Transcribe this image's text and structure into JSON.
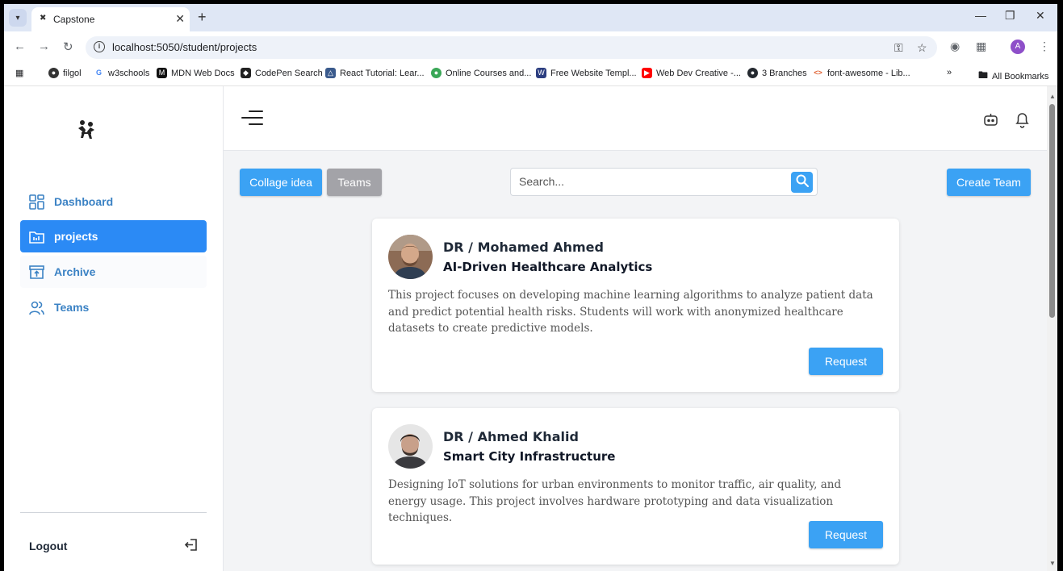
{
  "browser": {
    "tab_title": "Capstone",
    "url": "localhost:5050/student/projects",
    "profile_initial": "A",
    "bookmarks": [
      {
        "label": "filgol",
        "color": "#333333"
      },
      {
        "label": "w3schools",
        "color": "#4285f4"
      },
      {
        "label": "MDN Web Docs",
        "color": "#111111"
      },
      {
        "label": "CodePen Search",
        "color": "#222222"
      },
      {
        "label": "React Tutorial: Lear...",
        "color": "#3a5a8c"
      },
      {
        "label": "Online Courses and...",
        "color": "#3aa757"
      },
      {
        "label": "Free Website Templ...",
        "color": "#2c3e80"
      },
      {
        "label": "Web Dev Creative -...",
        "color": "#ff0000"
      },
      {
        "label": "3 Branches",
        "color": "#24292f"
      },
      {
        "label": "font-awesome - Lib...",
        "color": "#e06030"
      }
    ],
    "all_bookmarks": "All Bookmarks"
  },
  "sidebar": {
    "items": [
      {
        "label": "Dashboard",
        "icon": "grid-icon"
      },
      {
        "label": "projects",
        "icon": "folder-icon"
      },
      {
        "label": "Archive",
        "icon": "archive-icon"
      },
      {
        "label": "Teams",
        "icon": "users-icon"
      }
    ],
    "logout": "Logout"
  },
  "actions": {
    "collage_idea": "Collage idea",
    "teams": "Teams",
    "create_team": "Create Team"
  },
  "search": {
    "placeholder": "Search..."
  },
  "projects": [
    {
      "doctor": "DR / Mohamed Ahmed",
      "title": "AI-Driven Healthcare Analytics",
      "description": "This project focuses on developing machine learning algorithms to analyze patient data and predict potential health risks. Students will work with anonymized healthcare datasets to create predictive models.",
      "button": "Request"
    },
    {
      "doctor": "DR / Ahmed Khalid",
      "title": "Smart City Infrastructure",
      "description": "Designing IoT solutions for urban environments to monitor traffic, air quality, and energy usage. This project involves hardware prototyping and data visualization techniques.",
      "button": "Request"
    }
  ]
}
